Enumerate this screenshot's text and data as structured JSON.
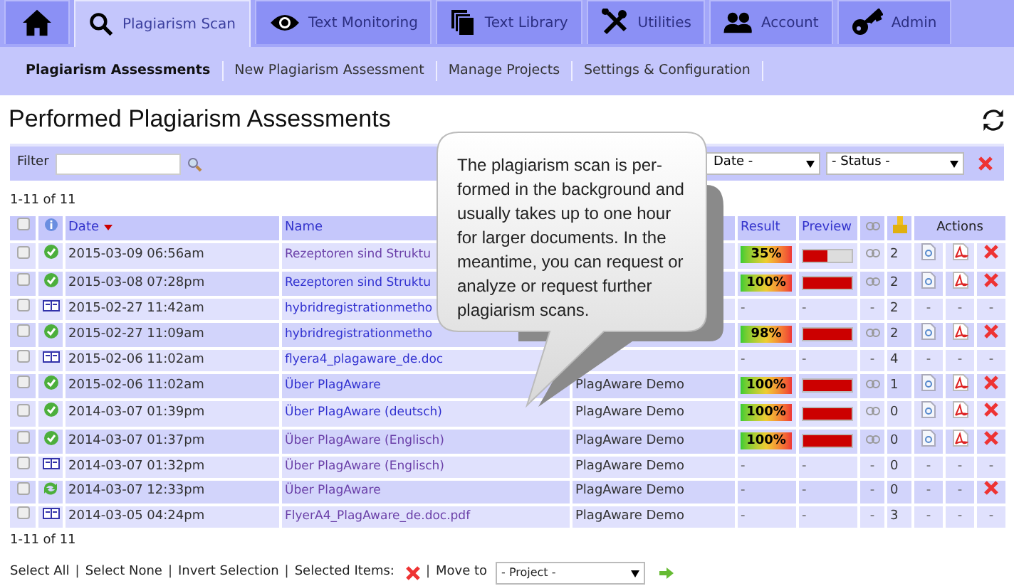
{
  "tabs": [
    {
      "selected": false
    },
    {
      "label": "Plagiarism Scan",
      "selected": true
    },
    {
      "label": "Text Monitoring",
      "selected": false
    },
    {
      "label": "Text Library",
      "selected": false
    },
    {
      "label": "Utilities",
      "selected": false
    },
    {
      "label": "Account",
      "selected": false
    },
    {
      "label": "Admin",
      "selected": false
    }
  ],
  "subnav": [
    {
      "label": "Plagiarism Assessments",
      "selected": true
    },
    {
      "label": "New Plagiarism Assessment",
      "selected": false
    },
    {
      "label": "Manage Projects",
      "selected": false
    },
    {
      "label": "Settings & Configuration",
      "selected": false
    }
  ],
  "title": "Performed Plagiarism Assessments",
  "filter": {
    "label": "Filter",
    "date_select": "Date -",
    "status_select": "- Status -"
  },
  "count_top": "1-11 of 11",
  "columns": {
    "date": "Date",
    "name": "Name",
    "result": "Result",
    "preview": "Preview",
    "actions": "Actions"
  },
  "select_all_checked": false,
  "rows": [
    {
      "checked": false,
      "kind": "done",
      "date": "2015-03-09 06:56am",
      "name": "Rezeptoren sind Struktu",
      "visited": true,
      "result": "35%",
      "preview": {
        "level": 0.5
      },
      "link": true,
      "count": "2",
      "actions": [
        {
          "kind": "report"
        },
        {
          "kind": "pdf"
        },
        {
          "kind": "delete"
        }
      ]
    },
    {
      "checked": false,
      "kind": "done",
      "date": "2015-03-08 07:28pm",
      "name": "Rezeptoren sind Struktu",
      "visited": false,
      "result": "100%",
      "preview": {
        "level": 1
      },
      "link": true,
      "count": "2",
      "actions": [
        {
          "kind": "report"
        },
        {
          "kind": "pdf"
        },
        {
          "kind": "delete"
        }
      ]
    },
    {
      "checked": false,
      "kind": "text",
      "date": "2015-02-27 11:42am",
      "name": "hybridregistrationmetho",
      "visited": false,
      "result": "-",
      "preview": "-",
      "link": "-",
      "count": "2",
      "actions": [
        "-",
        "-",
        "-"
      ]
    },
    {
      "checked": false,
      "kind": "done",
      "date": "2015-02-27 11:09am",
      "name": "hybridregistrationmetho",
      "visited": false,
      "result": "98%",
      "preview": {
        "level": 1
      },
      "link": true,
      "count": "2",
      "actions": [
        {
          "kind": "report"
        },
        {
          "kind": "pdf"
        },
        {
          "kind": "delete"
        }
      ]
    },
    {
      "checked": false,
      "kind": "text",
      "date": "2015-02-06 11:02am",
      "name": "flyera4_plagaware_de.doc",
      "visited": false,
      "result": "-",
      "preview": "-",
      "link": "-",
      "count": "4",
      "actions": [
        "-",
        "-",
        "-"
      ]
    },
    {
      "checked": false,
      "kind": "done",
      "date": "2015-02-06 11:02am",
      "name": "Über PlagAware",
      "visited": false,
      "project": "PlagAware Demo",
      "result": "100%",
      "preview": {
        "level": 1
      },
      "link": true,
      "count": "1",
      "actions": [
        {
          "kind": "report"
        },
        {
          "kind": "pdf"
        },
        {
          "kind": "delete"
        }
      ]
    },
    {
      "checked": false,
      "kind": "done",
      "date": "2014-03-07 01:39pm",
      "name": "Über PlagAware (deutsch)",
      "visited": false,
      "project": "PlagAware Demo",
      "result": "100%",
      "preview": {
        "level": 1
      },
      "link": true,
      "count": "0",
      "actions": [
        {
          "kind": "report"
        },
        {
          "kind": "pdf"
        },
        {
          "kind": "delete"
        }
      ]
    },
    {
      "checked": false,
      "kind": "done",
      "date": "2014-03-07 01:37pm",
      "name": "Über PlagAware (Englisch)",
      "visited": true,
      "project": "PlagAware Demo",
      "result": "100%",
      "preview": {
        "level": 1
      },
      "link": true,
      "count": "0",
      "actions": [
        {
          "kind": "report"
        },
        {
          "kind": "pdf"
        },
        {
          "kind": "delete"
        }
      ]
    },
    {
      "checked": false,
      "kind": "text",
      "date": "2014-03-07 01:32pm",
      "name": "Über PlagAware (Englisch)",
      "visited": true,
      "project": "PlagAware Demo",
      "result": "-",
      "preview": "-",
      "link": "-",
      "count": "0",
      "actions": [
        "-",
        "-",
        "-"
      ]
    },
    {
      "checked": false,
      "kind": "processing",
      "date": "2014-03-07 12:33pm",
      "name": "Über PlagAware",
      "visited": true,
      "project": "PlagAware Demo",
      "result": "-",
      "preview": "-",
      "link": "-",
      "count": "0",
      "actions": [
        "-",
        "-",
        {
          "kind": "delete"
        }
      ]
    },
    {
      "checked": false,
      "kind": "text",
      "date": "2014-03-05 04:24pm",
      "name": "FlyerA4_PlagAware_de.doc.pdf",
      "visited": true,
      "project": "PlagAware Demo",
      "result": "-",
      "preview": "-",
      "link": "-",
      "count": "3",
      "actions": [
        "-",
        "-",
        "-"
      ]
    }
  ],
  "count_bottom": "1-11 of 11",
  "bulk": {
    "links": [
      "Select All",
      "Select None",
      "Invert Selection"
    ],
    "separator": "|",
    "selected_items": "Selected Items:",
    "move_to": "Move to",
    "project_select": "- Project -"
  },
  "callout": "The plagiarism scan is per-formed in the background and usually takes up to one hour for larger documents. In the meantime, you can request or analyze or request further plagiarism scans."
}
